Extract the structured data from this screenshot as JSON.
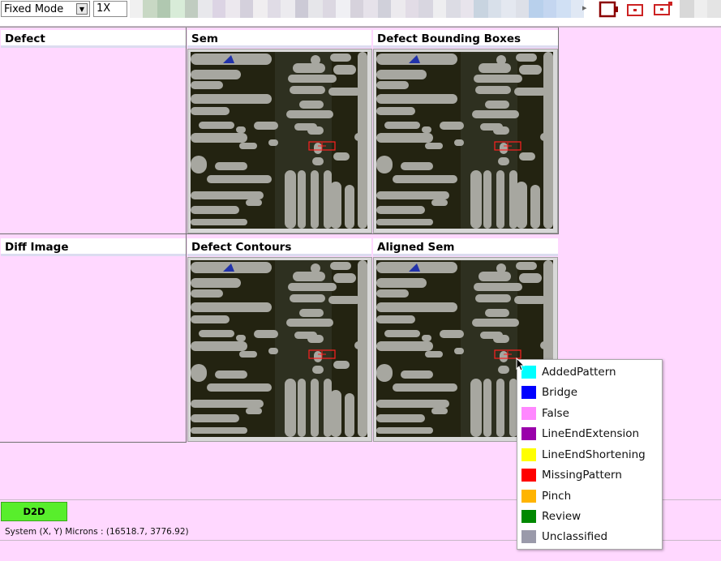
{
  "toolbar": {
    "mode_select": "Fixed Mode",
    "zoom_value": "1X"
  },
  "panels": [
    {
      "title": "Defect"
    },
    {
      "title": "Sem"
    },
    {
      "title": "Defect Bounding Boxes"
    },
    {
      "title": "Diff Image"
    },
    {
      "title": "Defect Contours"
    },
    {
      "title": "Aligned Sem"
    }
  ],
  "context_menu": {
    "items": [
      {
        "label": "AddedPattern",
        "color": "#00ffff"
      },
      {
        "label": "Bridge",
        "color": "#0000ff"
      },
      {
        "label": "False",
        "color": "#ff88ff"
      },
      {
        "label": "LineEndExtension",
        "color": "#9900aa"
      },
      {
        "label": "LineEndShortening",
        "color": "#ffff00"
      },
      {
        "label": "MissingPattern",
        "color": "#ff0000"
      },
      {
        "label": "Pinch",
        "color": "#ffb400"
      },
      {
        "label": "Review",
        "color": "#008800"
      },
      {
        "label": "Unclassified",
        "color": "#9a9aaa"
      }
    ]
  },
  "bottom": {
    "d2d_label": "D2D",
    "status_text": "System (X, Y) Microns : (16518.7, 3776.92)"
  },
  "colors": {
    "background": "#ffd8ff",
    "sem_background": "#232311",
    "sem_feature": "#a7a7a0",
    "defect_box": "#ff2020",
    "d2d_button": "#58ee2c"
  }
}
